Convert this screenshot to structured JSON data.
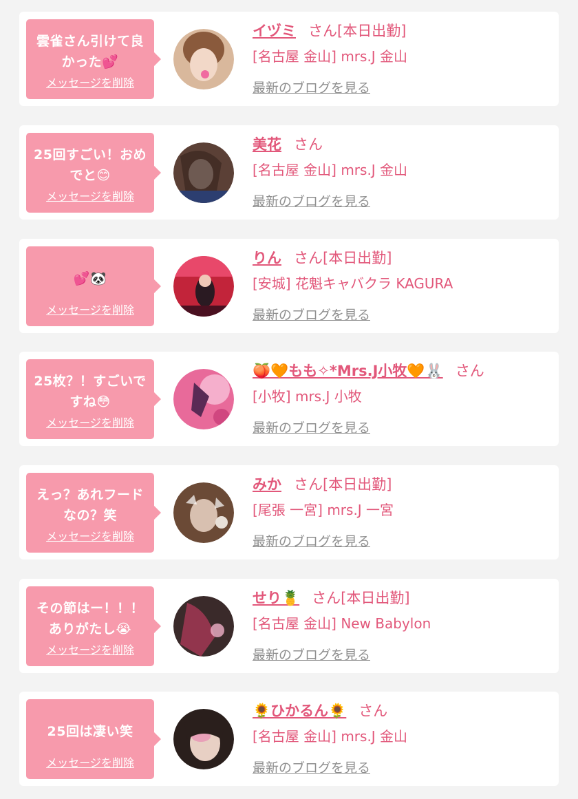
{
  "delete_label": "メッセージを削除",
  "blog_label": "最新のブログを見る",
  "colors": {
    "background": "#f3f3f3",
    "card": "#ffffff",
    "bubble": "#f79aac",
    "name_pink": "#e2577a",
    "link_gray": "#8f8f8f"
  },
  "items": [
    {
      "message": "雲雀さん引けて良かった💕",
      "name": "イヅミ",
      "suffix": "さん[本日出勤]",
      "shop": "[名古屋 金山] mrs.J 金山",
      "avatar_colors": [
        "#d9b89c",
        "#8a5a3c"
      ]
    },
    {
      "message": "25回すごい！おめでと😊",
      "name": "美花",
      "suffix": "さん",
      "shop": "[名古屋 金山] mrs.J 金山",
      "avatar_colors": [
        "#5b4036",
        "#e6d2c8"
      ]
    },
    {
      "message": "💕🐼",
      "name": "りん",
      "suffix": "さん[本日出勤]",
      "shop": "[安城] 花魁キャバクラ KAGURA",
      "avatar_colors": [
        "#c2243a",
        "#4a1020"
      ]
    },
    {
      "message": "25枚？！すごいですね😳",
      "name": "🍑🧡もも✧*Mrs.J小牧🧡🐰",
      "suffix": "さん",
      "shop": "[小牧] mrs.J 小牧",
      "avatar_colors": [
        "#e86a9a",
        "#5a2a55"
      ]
    },
    {
      "message": "えっ？あれフードなの？笑",
      "name": "みか",
      "suffix": "さん[本日出勤]",
      "shop": "[尾張 一宮] mrs.J 一宮",
      "avatar_colors": [
        "#6b4a36",
        "#d8c0b0"
      ]
    },
    {
      "message": "その節はー！！！ありがたし😭",
      "name": "せり🍍",
      "suffix": "さん[本日出勤]",
      "shop": "[名古屋 金山] New Babylon",
      "avatar_colors": [
        "#3a2a2a",
        "#b03a5a"
      ]
    },
    {
      "message": "25回は凄い笑",
      "name": "🌻ひかるん🌻",
      "suffix": "さん",
      "shop": "[名古屋 金山] mrs.J 金山",
      "avatar_colors": [
        "#2a1f1c",
        "#e8a0b8"
      ]
    }
  ]
}
